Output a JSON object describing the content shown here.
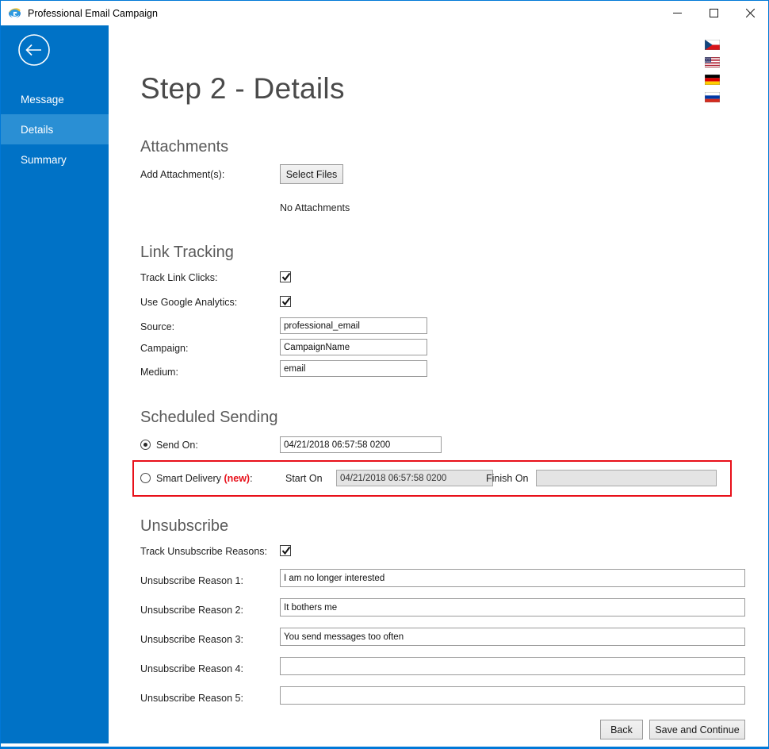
{
  "window": {
    "title": "Professional Email Campaign",
    "icon": "internet-explorer-icon",
    "controls": {
      "minimize": "minimize-icon",
      "maximize": "maximize-icon",
      "close": "close-icon"
    },
    "accent_color": "#0078d7"
  },
  "sidebar": {
    "background_color": "#0072c6",
    "active_color": "#2a8fd4",
    "back_button": "back-arrow-icon",
    "items": [
      {
        "label": "Message",
        "active": false
      },
      {
        "label": "Details",
        "active": true
      },
      {
        "label": "Summary",
        "active": false
      }
    ]
  },
  "languages": [
    {
      "name": "czech-flag"
    },
    {
      "name": "usa-flag"
    },
    {
      "name": "germany-flag"
    },
    {
      "name": "russia-flag"
    }
  ],
  "page": {
    "title": "Step 2 - Details"
  },
  "attachments": {
    "section_title": "Attachments",
    "add_label": "Add Attachment(s):",
    "select_button": "Select Files",
    "status": "No Attachments"
  },
  "link_tracking": {
    "section_title": "Link Tracking",
    "track_link_clicks": {
      "label": "Track Link Clicks:",
      "checked": true
    },
    "use_google_analytics": {
      "label": "Use Google Analytics:",
      "checked": true
    },
    "fields": [
      {
        "label": "Source:",
        "value": "professional_email"
      },
      {
        "label": "Campaign:",
        "value": "CampaignName"
      },
      {
        "label": "Medium:",
        "value": "email"
      }
    ]
  },
  "scheduled_sending": {
    "section_title": "Scheduled Sending",
    "send_on": {
      "label": "Send On:",
      "selected": true,
      "value": "04/21/2018 06:57:58 0200"
    },
    "smart_delivery": {
      "label": "Smart Delivery",
      "new_tag": "(new)",
      "colon": ":",
      "selected": false,
      "highlight_color": "#e8101a",
      "start_on_label": "Start On",
      "start_on_value": "04/21/2018 06:57:58 0200",
      "finish_on_label": "Finish On",
      "finish_on_value": "",
      "disabled": true
    }
  },
  "unsubscribe": {
    "section_title": "Unsubscribe",
    "track_reasons": {
      "label": "Track Unsubscribe Reasons:",
      "checked": true
    },
    "reasons": [
      {
        "label": "Unsubscribe Reason 1:",
        "value": "I am no longer interested"
      },
      {
        "label": "Unsubscribe Reason 2:",
        "value": "It bothers me"
      },
      {
        "label": "Unsubscribe Reason 3:",
        "value": "You send messages too often"
      },
      {
        "label": "Unsubscribe Reason 4:",
        "value": ""
      },
      {
        "label": "Unsubscribe Reason 5:",
        "value": ""
      }
    ]
  },
  "footer": {
    "back_button": "Back",
    "save_button": "Save and Continue"
  }
}
